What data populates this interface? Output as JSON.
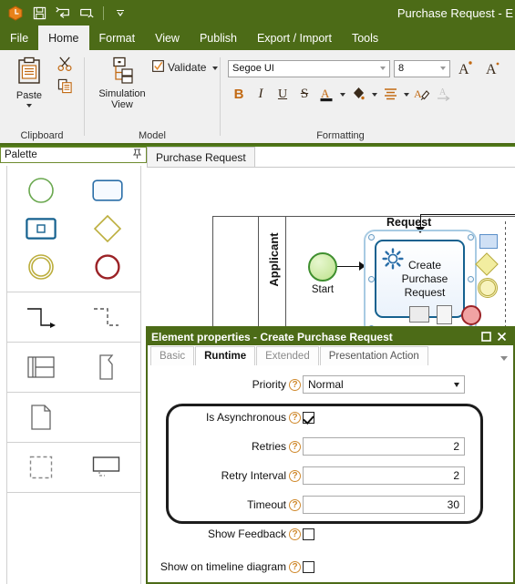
{
  "window": {
    "title": "Purchase Request - E",
    "quick_access": [
      {
        "name": "app-logo-icon",
        "label": "App"
      },
      {
        "name": "save-icon",
        "label": "Save"
      },
      {
        "name": "undo-icon",
        "label": "Undo"
      },
      {
        "name": "redo-icon",
        "label": "Redo"
      },
      {
        "name": "customize-qat-icon",
        "label": "Customize Quick Access Toolbar"
      }
    ],
    "colors": {
      "title_bar": "#4c6b17",
      "ribbon_bg": "#f0f0f0",
      "accent_orange": "#c26a13",
      "dialog_header": "#4c6b17"
    }
  },
  "ribbon": {
    "tabs": [
      {
        "label": "File",
        "active": false
      },
      {
        "label": "Home",
        "active": true
      },
      {
        "label": "Format",
        "active": false
      },
      {
        "label": "View",
        "active": false
      },
      {
        "label": "Publish",
        "active": false
      },
      {
        "label": "Export / Import",
        "active": false
      },
      {
        "label": "Tools",
        "active": false
      }
    ],
    "groups": [
      {
        "name": "clipboard",
        "label": "Clipboard",
        "items": [
          {
            "name": "paste-button",
            "label": "Paste",
            "icon": "clipboard-icon"
          },
          {
            "name": "cut-button",
            "label": "",
            "icon": "scissors-icon"
          },
          {
            "name": "copy-button",
            "label": "",
            "icon": "copy-icon"
          }
        ]
      },
      {
        "name": "model",
        "label": "Model",
        "items": [
          {
            "name": "simulation-view-button",
            "label": "Simulation View",
            "icon": "hierarchy-icon"
          },
          {
            "name": "validate-button",
            "label": "Validate",
            "icon": "checkbox-checked-icon"
          }
        ]
      },
      {
        "name": "formatting",
        "label": "Formatting",
        "font_name": "Segoe UI",
        "font_size": "8",
        "buttons": [
          {
            "name": "bold-button",
            "label": "B"
          },
          {
            "name": "italic-button",
            "label": "I"
          },
          {
            "name": "underline-button",
            "label": "U"
          },
          {
            "name": "strikethrough-button",
            "label": "S"
          },
          {
            "name": "font-color-button",
            "label": "A"
          },
          {
            "name": "fill-color-button",
            "label": "fill"
          },
          {
            "name": "align-button",
            "label": "align"
          },
          {
            "name": "format-painter-button",
            "label": "painter"
          },
          {
            "name": "clear-formatting-button",
            "label": "clear"
          },
          {
            "name": "grow-font-button",
            "label": "A"
          },
          {
            "name": "shrink-font-button",
            "label": "A"
          }
        ]
      }
    ]
  },
  "palette": {
    "title": "Palette",
    "pin_icon": "pin-icon",
    "sections": [
      {
        "name": "events-activities",
        "shapes": [
          {
            "name": "start-event-shape",
            "kind": "circle-green"
          },
          {
            "name": "task-shape",
            "kind": "rounded-rect-blue"
          },
          {
            "name": "subprocess-shape",
            "kind": "rect-nested-blue"
          },
          {
            "name": "gateway-shape",
            "kind": "diamond-yellow"
          },
          {
            "name": "intermediate-event-shape",
            "kind": "double-circle-olive"
          },
          {
            "name": "end-event-shape",
            "kind": "circle-red"
          }
        ]
      },
      {
        "name": "connectors",
        "shapes": [
          {
            "name": "sequence-flow-shape",
            "kind": "solid-elbow-arrow"
          },
          {
            "name": "message-flow-shape",
            "kind": "dashed-elbow-arrow"
          }
        ]
      },
      {
        "name": "pools-lanes",
        "shapes": [
          {
            "name": "pool-shape",
            "kind": "table-grid"
          },
          {
            "name": "lane-shape",
            "kind": "folded-bracket"
          }
        ]
      },
      {
        "name": "artifacts",
        "shapes": [
          {
            "name": "data-object-shape",
            "kind": "document-page"
          }
        ]
      },
      {
        "name": "annotations",
        "shapes": [
          {
            "name": "group-shape",
            "kind": "dashed-square"
          },
          {
            "name": "text-annotation-shape",
            "kind": "callout-box"
          }
        ]
      }
    ]
  },
  "canvas": {
    "tabs": [
      {
        "label": "Purchase Request",
        "active": true
      }
    ],
    "diagram": {
      "lane_label": "Applicant",
      "start_event_label": "Start",
      "task_label": "Create\nPurchase\nRequest",
      "task_label_lines": [
        "Create",
        "Purchase",
        "Request"
      ],
      "annotation_label": "Request",
      "task_icon": "gear-icon",
      "quick_palette": [
        {
          "name": "quick-task-shape",
          "kind": "rect-blue"
        },
        {
          "name": "quick-gateway-shape",
          "kind": "diamond-yellow"
        },
        {
          "name": "quick-intermediate-event-shape",
          "kind": "ring-olive"
        },
        {
          "name": "quick-end-event-shape",
          "kind": "circle-red"
        },
        {
          "name": "quick-subprocess-shape",
          "kind": "rect-gray"
        },
        {
          "name": "quick-data-object-shape",
          "kind": "document-page"
        }
      ]
    }
  },
  "dialog": {
    "title": "Element properties - Create Purchase Request",
    "buttons": [
      {
        "name": "maximize-button",
        "icon": "maximize-icon"
      },
      {
        "name": "close-button",
        "icon": "close-icon"
      }
    ],
    "tabs": [
      {
        "label": "Basic",
        "active": false
      },
      {
        "label": "Runtime",
        "active": true
      },
      {
        "label": "Extended",
        "active": false
      },
      {
        "label": "Presentation Action",
        "active": false
      }
    ],
    "overflow_icon": "chevron-down-icon",
    "fields": [
      {
        "name": "priority-field",
        "label": "Priority",
        "type": "select",
        "value": "Normal",
        "help_icon": "help-icon"
      },
      {
        "name": "is-asynchronous-field",
        "label": "Is Asynchronous",
        "type": "checkbox",
        "checked": true,
        "help_icon": "help-icon"
      },
      {
        "name": "retries-field",
        "label": "Retries",
        "type": "number",
        "value": "2",
        "help_icon": "help-icon"
      },
      {
        "name": "retry-interval-field",
        "label": "Retry Interval",
        "type": "number",
        "value": "2",
        "help_icon": "help-icon"
      },
      {
        "name": "timeout-field",
        "label": "Timeout",
        "type": "number",
        "value": "30",
        "help_icon": "help-icon"
      },
      {
        "name": "show-feedback-field",
        "label": "Show Feedback",
        "type": "checkbox",
        "checked": false,
        "help_icon": "help-icon"
      },
      {
        "name": "show-on-timeline-field",
        "label": "Show on timeline diagram",
        "type": "checkbox",
        "checked": false,
        "help_icon": "help-icon"
      }
    ]
  }
}
